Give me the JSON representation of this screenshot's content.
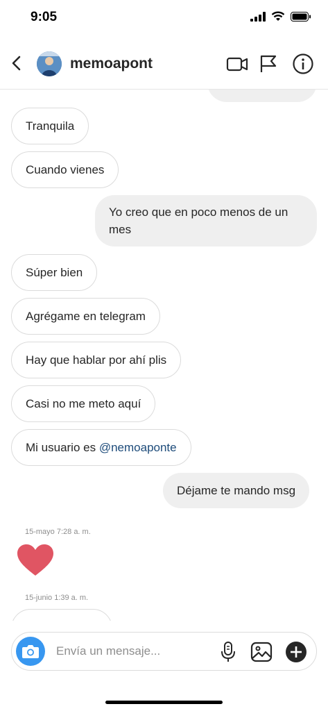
{
  "status": {
    "time": "9:05"
  },
  "header": {
    "username": "memoapont"
  },
  "messages": {
    "m1": "Tranquila",
    "m2": "Cuando vienes",
    "m3_line1": "Yo creo que en poco menos de un",
    "m3_line2": "mes",
    "m4": "Súper bien",
    "m5": "Agrégame en telegram",
    "m6": "Hay que hablar por ahí plis",
    "m7": "Casi no me meto aquí",
    "m8_text": "Mi usuario es ",
    "m8_mention": "@nemoaponte",
    "m9": "Déjame te mando msg",
    "ts1": "15-mayo 7:28 a. m.",
    "ts2": "15-junio 1:39 a. m."
  },
  "composer": {
    "placeholder": "Envía un mensaje..."
  },
  "colors": {
    "accent": "#3897f0",
    "heart": "#e05563",
    "mention": "#1d4b7a"
  }
}
